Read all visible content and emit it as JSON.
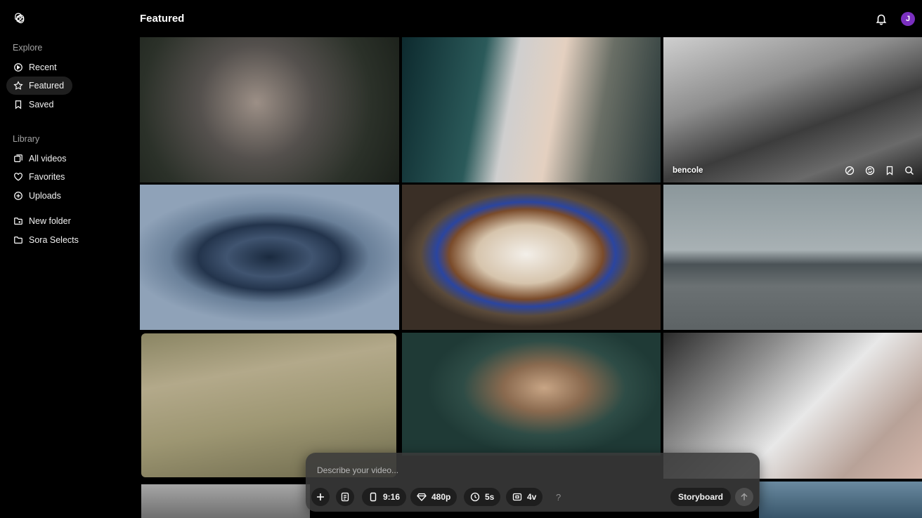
{
  "app": {
    "logo_icon": "openai-logo-icon"
  },
  "header": {
    "title": "Featured",
    "avatar_initial": "J",
    "avatar_color": "#7a2fbf"
  },
  "sidebar": {
    "explore_heading": "Explore",
    "explore_items": [
      {
        "label": "Recent",
        "icon": "clock-icon",
        "active": false
      },
      {
        "label": "Featured",
        "icon": "star-icon",
        "active": true
      },
      {
        "label": "Saved",
        "icon": "bookmark-icon",
        "active": false
      }
    ],
    "library_heading": "Library",
    "library_items": [
      {
        "label": "All videos",
        "icon": "videos-icon"
      },
      {
        "label": "Favorites",
        "icon": "heart-icon"
      },
      {
        "label": "Uploads",
        "icon": "upload-icon"
      }
    ],
    "folder_items": [
      {
        "label": "New folder",
        "icon": "new-folder-icon"
      },
      {
        "label": "Sora Selects",
        "icon": "folder-icon"
      }
    ]
  },
  "grid": {
    "hovered_tile_author": "bencole"
  },
  "composer": {
    "placeholder": "Describe your video...",
    "aspect_ratio": "9:16",
    "resolution": "480p",
    "duration": "5s",
    "variations": "4v",
    "help": "?",
    "storyboard_label": "Storyboard"
  }
}
